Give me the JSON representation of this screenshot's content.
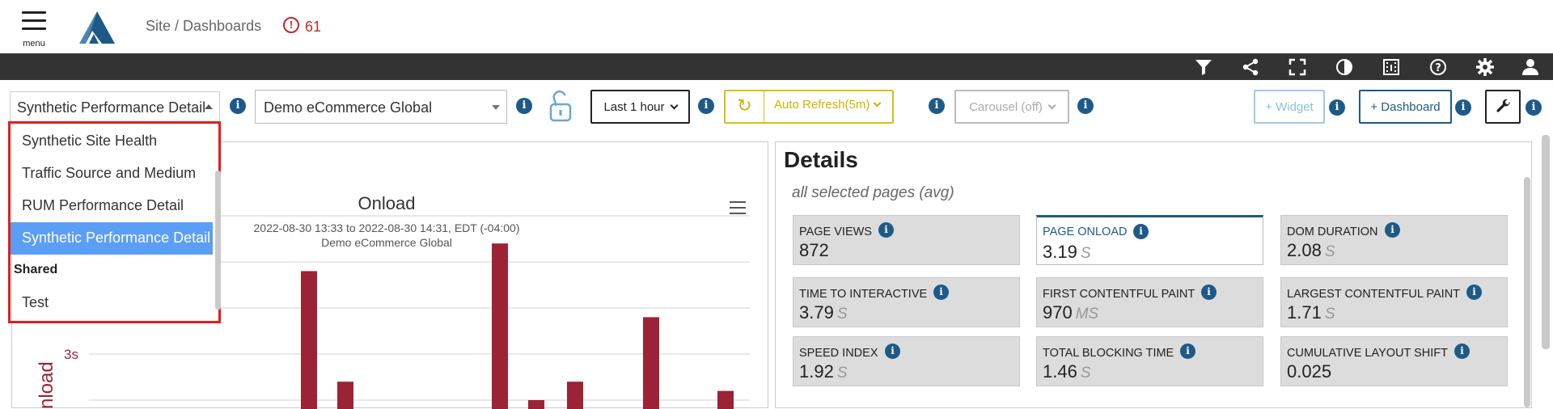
{
  "header": {
    "menu_label": "menu",
    "breadcrumb": "Site / Dashboards",
    "alert_icon": "!",
    "alert_count": "61"
  },
  "toolbar": {
    "dashboard_select": "Synthetic Performance Detail",
    "site_select": "Demo eCommerce Global",
    "time_range": "Last 1 hour",
    "auto_refresh": "Auto Refresh(5m)",
    "refresh_icon": "↻",
    "carousel": "Carousel (off)",
    "add_widget": "+ Widget",
    "add_dashboard": "+ Dashboard",
    "info_glyph": "i"
  },
  "dropdown": {
    "items": [
      {
        "label": "Synthetic Site Health"
      },
      {
        "label": "Traffic Source and Medium"
      },
      {
        "label": "RUM Performance Detail"
      },
      {
        "label": "Synthetic Performance Detail"
      }
    ],
    "group_label": "Shared",
    "group_items": [
      {
        "label": "Test"
      }
    ]
  },
  "chart_data": {
    "type": "bar",
    "title": "Onload",
    "subtitle_line1": "2022-08-30 13:33 to 2022-08-30 14:31, EDT (-04:00)",
    "subtitle_line2": "Demo eCommerce Global",
    "ylabel": "nload",
    "ytick_label": "3s",
    "ytick_value": 3,
    "series_color": "#9b2335",
    "values": [
      3.9,
      2.7,
      4.2,
      2.5,
      2.7,
      3.4,
      2.4,
      2.6
    ]
  },
  "details": {
    "title": "Details",
    "subtitle": "all selected pages (avg)",
    "cards": [
      {
        "name": "PAGE VIEWS",
        "value": "872",
        "unit": ""
      },
      {
        "name": "PAGE ONLOAD",
        "value": "3.19",
        "unit": "S"
      },
      {
        "name": "DOM DURATION",
        "value": "2.08",
        "unit": "S"
      },
      {
        "name": "TIME TO INTERACTIVE",
        "value": "3.79",
        "unit": "S"
      },
      {
        "name": "FIRST CONTENTFUL PAINT",
        "value": "970",
        "unit": "MS"
      },
      {
        "name": "LARGEST CONTENTFUL PAINT",
        "value": "1.71",
        "unit": "S"
      },
      {
        "name": "SPEED INDEX",
        "value": "1.92",
        "unit": "S"
      },
      {
        "name": "TOTAL BLOCKING TIME",
        "value": "1.46",
        "unit": "S"
      },
      {
        "name": "CUMULATIVE LAYOUT SHIFT",
        "value": "0.025",
        "unit": ""
      }
    ]
  },
  "icons": [
    "filter-icon",
    "share-icon",
    "fullscreen-icon",
    "contrast-icon",
    "film-icon",
    "help-icon",
    "settings-icon",
    "user-icon"
  ]
}
